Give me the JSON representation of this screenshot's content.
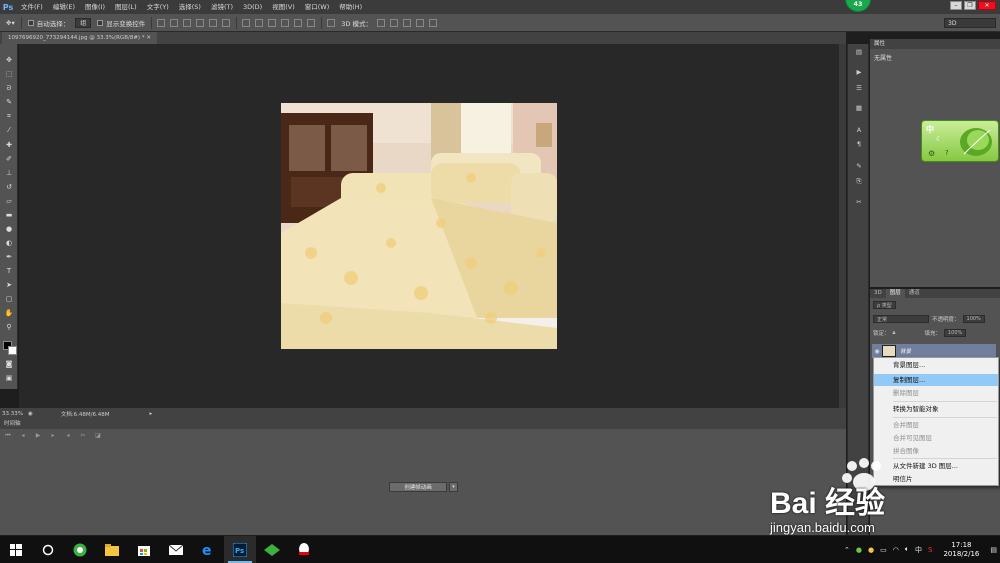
{
  "app": {
    "logo": "Ps",
    "menu": [
      "文件(F)",
      "编辑(E)",
      "图像(I)",
      "图层(L)",
      "文字(Y)",
      "选择(S)",
      "滤镜(T)",
      "3D(D)",
      "视图(V)",
      "窗口(W)",
      "帮助(H)"
    ],
    "notification_badge": "43"
  },
  "options_bar": {
    "auto_select_label": "自动选择：",
    "auto_select_value": "组",
    "show_transform_label": "显示变换控件",
    "mode_3d_label": "3D 模式：",
    "workspace_select": "3D"
  },
  "document": {
    "tab_label": "1097696920_773294144.jpg @ 33.3%(RGB/8#) *",
    "zoom": "33.33%",
    "doc_info": "文档:6.48M/6.48M"
  },
  "timeline": {
    "panel_title": "时间轴",
    "create_button": "创建帧动画"
  },
  "properties": {
    "panel_title": "属性",
    "content": "无属性"
  },
  "layers_panel": {
    "tabs": [
      "3D",
      "图层",
      "通道"
    ],
    "active_tab": "图层",
    "filter_kind": "ρ 类型",
    "blend_mode": "正常",
    "opacity_label": "不透明度：",
    "opacity_value": "100%",
    "lock_label": "锁定：",
    "fill_label": "填充：",
    "fill_value": "100%",
    "layer_name": "背景"
  },
  "context_menu": {
    "items": [
      {
        "label": "背景图层...",
        "enabled": true
      },
      {
        "label": "复制图层...",
        "enabled": true,
        "highlighted": true
      },
      {
        "label": "删除图层",
        "enabled": false
      },
      {
        "label": "转换为智能对象",
        "enabled": true
      },
      {
        "label": "合并图层",
        "enabled": false
      },
      {
        "label": "合并可见图层",
        "enabled": false
      },
      {
        "label": "拼合图像",
        "enabled": false
      },
      {
        "label": "从文件新建 3D 图层...",
        "enabled": true
      },
      {
        "label": "明信片",
        "enabled": true
      }
    ]
  },
  "ime": {
    "char": "中"
  },
  "watermark": {
    "brand": "Bai 经验",
    "url": "jingyan.baidu.com"
  },
  "taskbar": {
    "apps": [
      "start-icon",
      "cortana-icon",
      "browser-360-icon",
      "file-explorer-icon",
      "store-icon",
      "mail-icon",
      "edge-icon",
      "photoshop-icon",
      "green-app-icon",
      "qq-icon"
    ],
    "ime_indicator": "中",
    "time": "17:18",
    "date": "2018/2/16"
  },
  "colors": {
    "panel": "#535353",
    "canvas_bg": "#282828",
    "menu_highlight": "#91c9f7",
    "layer_selected": "#6f7f9c"
  }
}
